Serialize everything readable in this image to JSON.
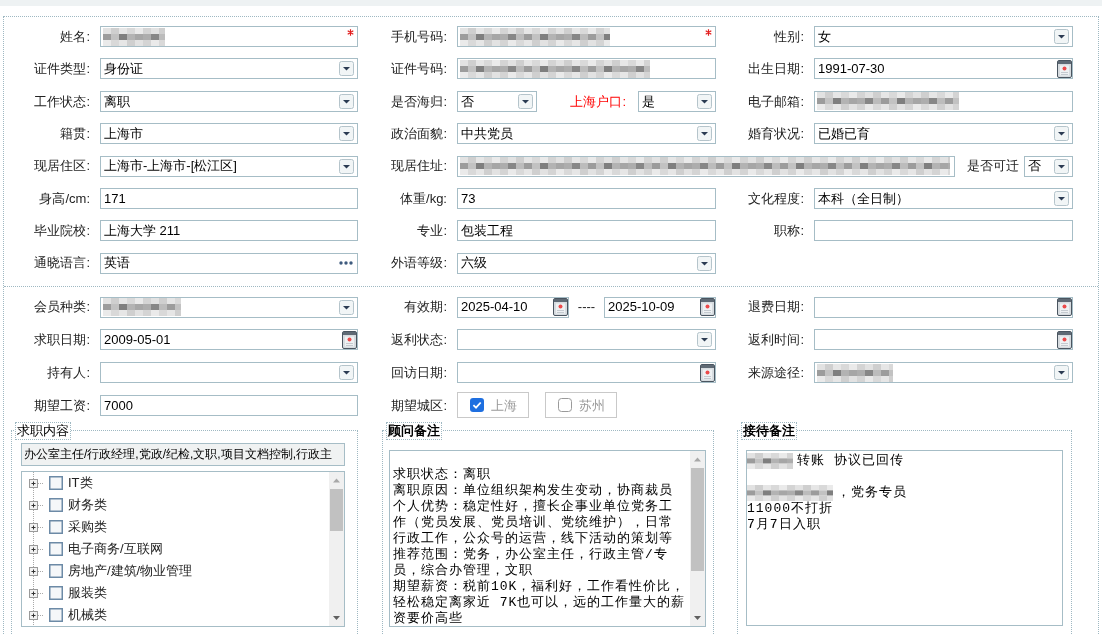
{
  "personal_section": {
    "rows": [
      {
        "cells": [
          {
            "label": "姓名:",
            "kind": "text",
            "redacted": true,
            "required": true,
            "highlight": false
          },
          {
            "label": "手机号码:",
            "kind": "text",
            "redacted": true,
            "required": true,
            "highlight": false
          },
          {
            "label": "性别:",
            "kind": "select",
            "value": "女",
            "redacted": false,
            "required": false,
            "highlight": false
          }
        ]
      },
      {
        "cells": [
          {
            "label": "证件类型:",
            "kind": "select",
            "value": "身份证",
            "redacted": false,
            "required": false,
            "highlight": false
          },
          {
            "label": "证件号码:",
            "kind": "text",
            "redacted": true,
            "required": false,
            "highlight": false
          },
          {
            "label": "出生日期:",
            "kind": "date",
            "value": "1991-07-30",
            "redacted": false,
            "required": false,
            "highlight": false
          }
        ]
      },
      {
        "cells": [
          {
            "label": "工作状态:",
            "kind": "select",
            "value": "离职",
            "redacted": false,
            "required": false,
            "highlight": false
          },
          {
            "label": "是否海归:",
            "kind": "select",
            "value": "否",
            "redacted": false,
            "required": false,
            "highlight": false,
            "extra": {
              "label": "上海户口:",
              "kind": "select",
              "value": "是",
              "redacted": false,
              "required": false,
              "highlight": true
            }
          },
          {
            "label": "电子邮箱:",
            "kind": "text",
            "redacted": true,
            "required": false,
            "highlight": false
          }
        ]
      },
      {
        "cells": [
          {
            "label": "籍贯:",
            "kind": "select",
            "value": "上海市",
            "redacted": false,
            "required": false,
            "highlight": false
          },
          {
            "label": "政治面貌:",
            "kind": "select",
            "value": "中共党员",
            "redacted": false,
            "required": false,
            "highlight": false
          },
          {
            "label": "婚育状况:",
            "kind": "select",
            "value": "已婚已育",
            "redacted": false,
            "required": false,
            "highlight": false
          }
        ]
      },
      {
        "cells": [
          {
            "label": "现居住区:",
            "kind": "select",
            "value": "上海市-上海市-[松江区]",
            "redacted": false,
            "required": false,
            "highlight": false
          },
          {
            "label": "现居住址:",
            "kind": "text",
            "redacted": true,
            "wide": true,
            "required": false,
            "highlight": false,
            "extra": {
              "label": "是否可迁",
              "kind": "select",
              "value": "否",
              "redacted": false,
              "required": false,
              "highlight": false
            }
          }
        ]
      },
      {
        "cells": [
          {
            "label": "身高/cm:",
            "kind": "text",
            "value": "171",
            "redacted": false,
            "required": false,
            "highlight": false
          },
          {
            "label": "体重/kg:",
            "kind": "text",
            "value": "73",
            "redacted": false,
            "required": false,
            "highlight": false
          },
          {
            "label": "文化程度:",
            "kind": "select",
            "value": "本科（全日制）",
            "redacted": false,
            "required": false,
            "highlight": false
          }
        ]
      },
      {
        "cells": [
          {
            "label": "毕业院校:",
            "kind": "text",
            "value": "上海大学 211",
            "redacted": false,
            "required": false,
            "highlight": false
          },
          {
            "label": "专业:",
            "kind": "text",
            "value": "包装工程",
            "redacted": false,
            "required": false,
            "highlight": false
          },
          {
            "label": "职称:",
            "kind": "text",
            "redacted": false,
            "required": false,
            "highlight": false
          }
        ]
      },
      {
        "cells": [
          {
            "label": "通晓语言:",
            "kind": "lookup",
            "value": "英语",
            "redacted": false,
            "required": false,
            "highlight": false
          },
          {
            "label": "外语等级:",
            "kind": "select",
            "value": "六级",
            "redacted": false,
            "required": false,
            "highlight": false
          }
        ]
      }
    ]
  },
  "membership_section": {
    "rows": [
      {
        "cells": [
          {
            "label": "会员种类:",
            "kind": "select",
            "redacted": true,
            "required": false,
            "highlight": false
          },
          {
            "label": "有效期:",
            "kind": "date_range",
            "values": [
              "2025-04-10",
              "2025-10-09"
            ],
            "separator": "----",
            "redacted": false,
            "required": false,
            "highlight": false
          },
          {
            "label": "退费日期:",
            "kind": "date",
            "redacted": false,
            "required": false,
            "highlight": false
          }
        ]
      },
      {
        "cells": [
          {
            "label": "求职日期:",
            "kind": "date",
            "value": "2009-05-01",
            "redacted": false,
            "required": false,
            "highlight": false
          },
          {
            "label": "返利状态:",
            "kind": "select",
            "redacted": false,
            "required": false,
            "highlight": false
          },
          {
            "label": "返利时间:",
            "kind": "date",
            "redacted": false,
            "required": false,
            "highlight": false
          }
        ]
      },
      {
        "cells": [
          {
            "label": "持有人:",
            "kind": "select",
            "redacted": false,
            "required": false,
            "highlight": false
          },
          {
            "label": "回访日期:",
            "kind": "date",
            "redacted": false,
            "required": false,
            "highlight": false
          },
          {
            "label": "来源途径:",
            "kind": "select",
            "redacted": true,
            "required": false,
            "highlight": false
          }
        ]
      },
      {
        "cells": [
          {
            "label": "期望工资:",
            "kind": "text",
            "value": "7000",
            "redacted": false,
            "required": false,
            "highlight": false
          },
          {
            "label": "期望城区:",
            "kind": "options",
            "options": [
              {
                "label": "上海",
                "checked": true
              },
              {
                "label": "苏州",
                "checked": false
              }
            ],
            "redacted": false,
            "required": false,
            "highlight": false
          }
        ]
      }
    ]
  },
  "groups": [
    {
      "kind": "job_categories",
      "legend": "求职内容",
      "bold": false,
      "selection": "办公室主任/行政经理,党政/纪检,文职,项目文档控制,行政主",
      "tree": [
        {
          "label": "IT类",
          "expanded": false,
          "checked": false
        },
        {
          "label": "财务类",
          "expanded": false,
          "checked": false
        },
        {
          "label": "采购类",
          "expanded": false,
          "checked": false
        },
        {
          "label": "电子商务/互联网",
          "expanded": false,
          "checked": false
        },
        {
          "label": "房地产/建筑/物业管理",
          "expanded": false,
          "checked": false
        },
        {
          "label": "服装类",
          "expanded": false,
          "checked": false
        },
        {
          "label": "机械类",
          "expanded": false,
          "checked": false
        }
      ]
    },
    {
      "kind": "notes",
      "legend": "顾问备注",
      "bold": true,
      "lines": [
        "求职状态：离职",
        "离职原因：单位组织架构发生变动，协商裁员",
        "个人优势：稳定性好，擅长企事业单位党务工作（党员发展、党员培训、党统维护），日常行政工作，公众号的运营，线下活动的策划等",
        "推荐范围：党务，办公室主任，行政主管/专员，综合办管理，文职",
        "期望薪资：税前10K，福利好，工作看性价比，轻松稳定离家近 7K也可以，远的工作量大的薪资要价高些"
      ]
    },
    {
      "kind": "reception_notes",
      "legend": "接待备注",
      "bold": true,
      "paragraphs": [
        {
          "lines": [
            {
              "redacted": true,
              "text": "转账 协议已回传"
            }
          ]
        },
        {
          "lines": [
            {
              "redacted": true,
              "text": "，党务专员"
            },
            {
              "redacted": false,
              "text": "11000不打折"
            },
            {
              "redacted": false,
              "text": "7月7日入职"
            }
          ]
        }
      ]
    }
  ]
}
